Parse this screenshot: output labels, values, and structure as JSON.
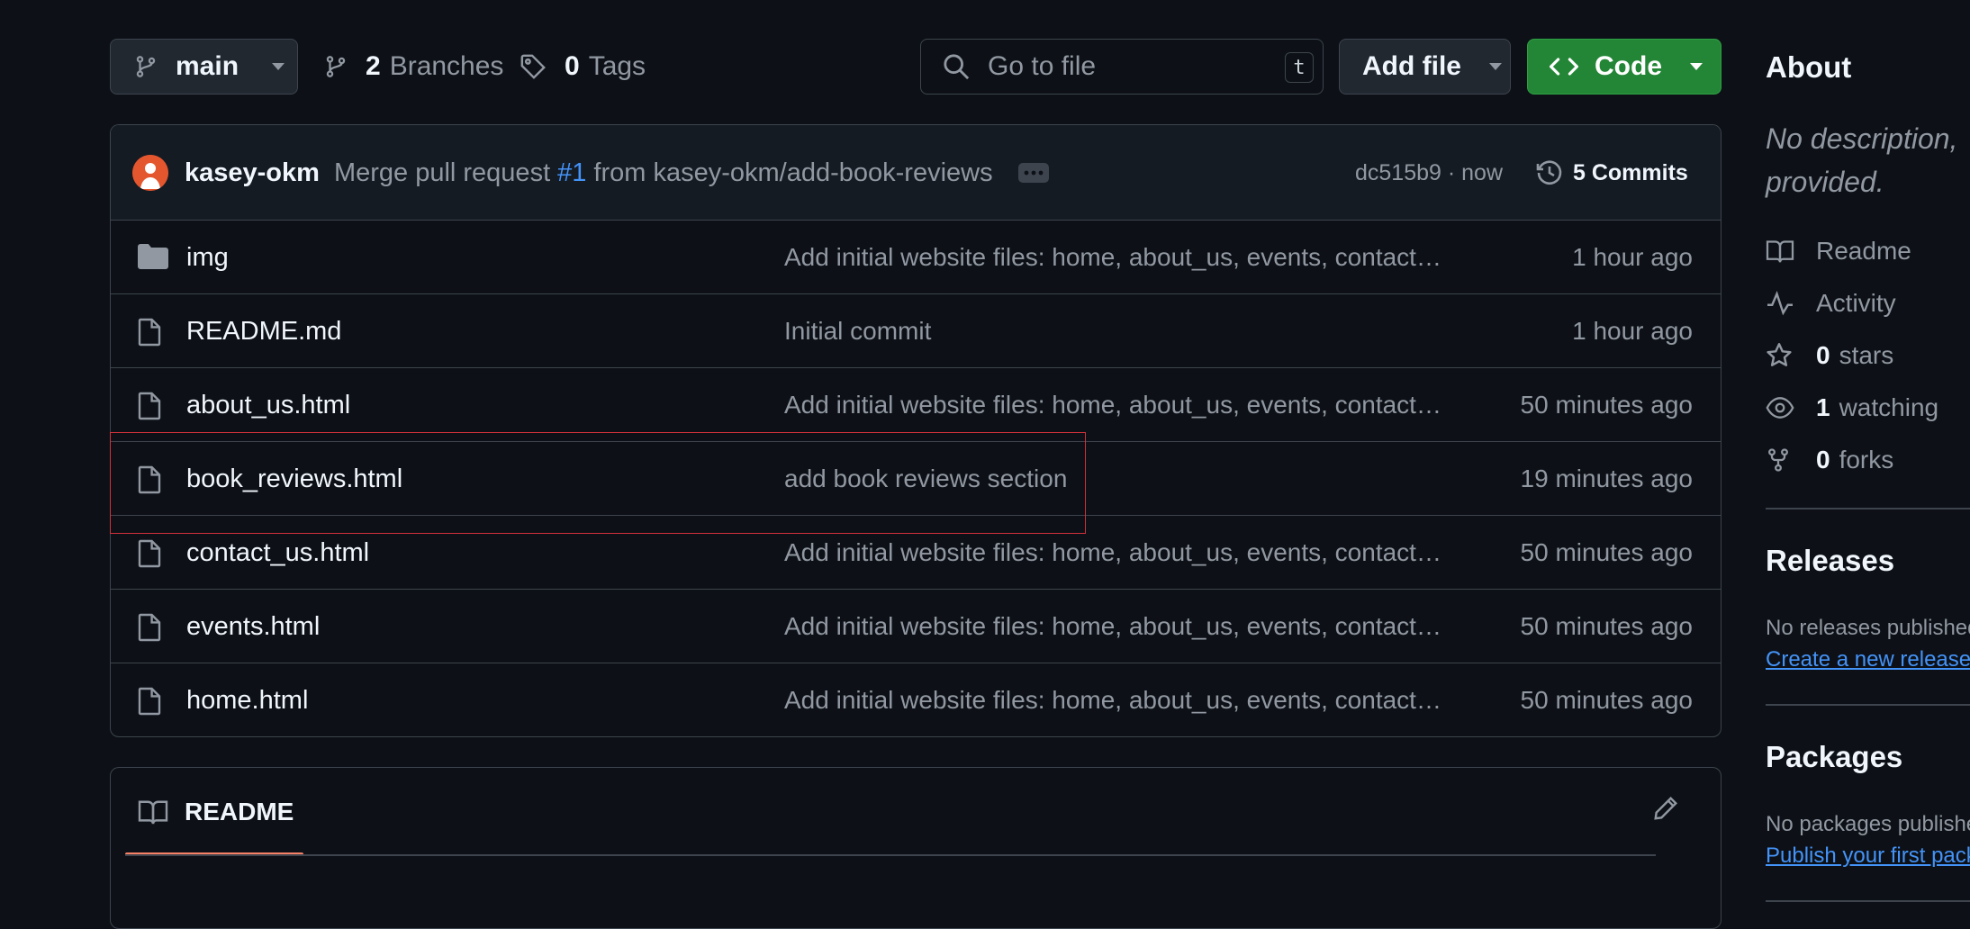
{
  "toolbar": {
    "branch": "main",
    "branches_count": "2",
    "branches_label": "Branches",
    "tags_count": "0",
    "tags_label": "Tags",
    "search_placeholder": "Go to file",
    "search_shortcut": "t",
    "add_file_label": "Add file",
    "code_label": "Code",
    "code_color": "#238636"
  },
  "commit": {
    "author": "kasey-okm",
    "message_prefix": "Merge pull request",
    "pr_ref": "#1",
    "message_suffix": "from kasey-okm/add-book-reviews",
    "sha_time": "dc515b9 · now",
    "commits_label": "5 Commits"
  },
  "files": [
    {
      "icon": "folder-icon",
      "name": "img",
      "message": "Add initial website files: home, about_us, events, contact…",
      "time": "1 hour ago"
    },
    {
      "icon": "file-icon",
      "name": "README.md",
      "message": "Initial commit",
      "time": "1 hour ago"
    },
    {
      "icon": "file-icon",
      "name": "about_us.html",
      "message": "Add initial website files: home, about_us, events, contact…",
      "time": "50 minutes ago"
    },
    {
      "icon": "file-icon",
      "name": "book_reviews.html",
      "message": "add book reviews section",
      "time": "19 minutes ago"
    },
    {
      "icon": "file-icon",
      "name": "contact_us.html",
      "message": "Add initial website files: home, about_us, events, contact…",
      "time": "50 minutes ago"
    },
    {
      "icon": "file-icon",
      "name": "events.html",
      "message": "Add initial website files: home, about_us, events, contact…",
      "time": "50 minutes ago"
    },
    {
      "icon": "file-icon",
      "name": "home.html",
      "message": "Add initial website files: home, about_us, events, contact…",
      "time": "50 minutes ago"
    }
  ],
  "readme": {
    "tab_label": "README",
    "accent": "#f78166"
  },
  "sidebar": {
    "about_title": "About",
    "description_line1": "No description,",
    "description_line2": "provided.",
    "readme_label": "Readme",
    "activity_label": "Activity",
    "stars_count": "0",
    "stars_label": "stars",
    "watching_count": "1",
    "watching_label": "watching",
    "forks_count": "0",
    "forks_label": "forks",
    "releases_title": "Releases",
    "releases_text": "No releases published",
    "releases_link": "Create a new release",
    "packages_title": "Packages",
    "packages_text": "No packages published",
    "packages_link": "Publish your first package"
  }
}
